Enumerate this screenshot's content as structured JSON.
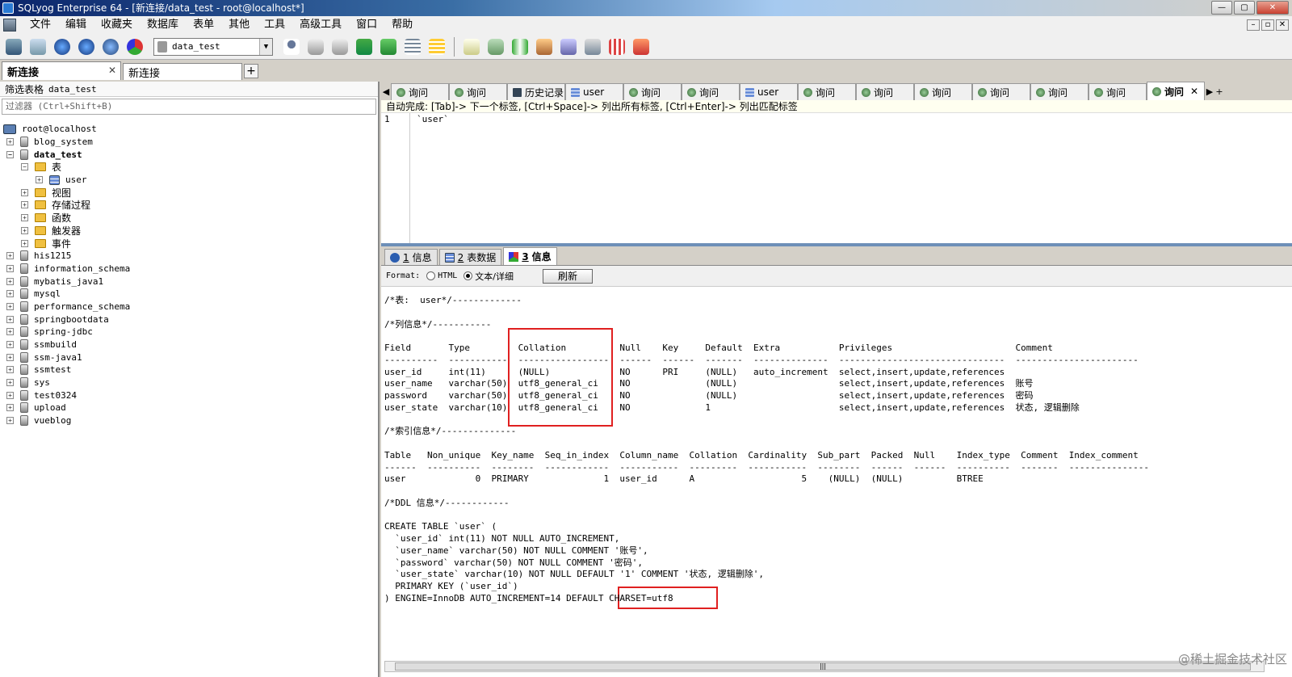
{
  "window": {
    "title": "SQLyog Enterprise 64 - [新连接/data_test - root@localhost*]"
  },
  "menu": [
    "文件",
    "编辑",
    "收藏夹",
    "数据库",
    "表单",
    "其他",
    "工具",
    "高级工具",
    "窗口",
    "帮助"
  ],
  "toolbar": {
    "database": "data_test"
  },
  "connection_tabs": [
    "新连接",
    "新连接"
  ],
  "object_browser": {
    "filter_label": "筛选表格",
    "filter_db": "data_test",
    "filter_placeholder": "过滤器 (Ctrl+Shift+B)",
    "root": "root@localhost",
    "nodes": [
      {
        "label": "blog_system",
        "level": 1,
        "type": "db",
        "exp": "+"
      },
      {
        "label": "data_test",
        "level": 1,
        "type": "db",
        "exp": "-",
        "bold": true
      },
      {
        "label": "表",
        "level": 2,
        "type": "folder",
        "exp": "-",
        "cn": true
      },
      {
        "label": "user",
        "level": 3,
        "type": "table",
        "exp": "+"
      },
      {
        "label": "视图",
        "level": 2,
        "type": "folder",
        "exp": "+",
        "cn": true
      },
      {
        "label": "存储过程",
        "level": 2,
        "type": "folder",
        "exp": "+",
        "cn": true
      },
      {
        "label": "函数",
        "level": 2,
        "type": "folder",
        "exp": "+",
        "cn": true
      },
      {
        "label": "触发器",
        "level": 2,
        "type": "folder",
        "exp": "+",
        "cn": true
      },
      {
        "label": "事件",
        "level": 2,
        "type": "folder",
        "exp": "+",
        "cn": true
      },
      {
        "label": "his1215",
        "level": 1,
        "type": "db",
        "exp": "+"
      },
      {
        "label": "information_schema",
        "level": 1,
        "type": "db",
        "exp": "+"
      },
      {
        "label": "mybatis_java1",
        "level": 1,
        "type": "db",
        "exp": "+"
      },
      {
        "label": "mysql",
        "level": 1,
        "type": "db",
        "exp": "+"
      },
      {
        "label": "performance_schema",
        "level": 1,
        "type": "db",
        "exp": "+"
      },
      {
        "label": "springbootdata",
        "level": 1,
        "type": "db",
        "exp": "+"
      },
      {
        "label": "spring-jdbc",
        "level": 1,
        "type": "db",
        "exp": "+"
      },
      {
        "label": "ssmbuild",
        "level": 1,
        "type": "db",
        "exp": "+"
      },
      {
        "label": "ssm-java1",
        "level": 1,
        "type": "db",
        "exp": "+"
      },
      {
        "label": "ssmtest",
        "level": 1,
        "type": "db",
        "exp": "+"
      },
      {
        "label": "sys",
        "level": 1,
        "type": "db",
        "exp": "+"
      },
      {
        "label": "test0324",
        "level": 1,
        "type": "db",
        "exp": "+"
      },
      {
        "label": "upload",
        "level": 1,
        "type": "db",
        "exp": "+"
      },
      {
        "label": "vueblog",
        "level": 1,
        "type": "db",
        "exp": "+"
      }
    ]
  },
  "query_tabs": [
    {
      "label": "询问",
      "icon": "query"
    },
    {
      "label": "询问",
      "icon": "query"
    },
    {
      "label": "历史记录",
      "icon": "history"
    },
    {
      "label": "user",
      "icon": "table"
    },
    {
      "label": "询问",
      "icon": "query"
    },
    {
      "label": "询问",
      "icon": "query"
    },
    {
      "label": "user",
      "icon": "table"
    },
    {
      "label": "询问",
      "icon": "query"
    },
    {
      "label": "询问",
      "icon": "query"
    },
    {
      "label": "询问",
      "icon": "query"
    },
    {
      "label": "询问",
      "icon": "query"
    },
    {
      "label": "询问",
      "icon": "query"
    },
    {
      "label": "询问",
      "icon": "query"
    },
    {
      "label": "询问",
      "icon": "query",
      "active": true
    }
  ],
  "autocomplete_hint": "自动完成: [Tab]-> 下一个标签, [Ctrl+Space]-> 列出所有标签, [Ctrl+Enter]-> 列出匹配标签",
  "editor": {
    "line_number": "1",
    "code": "`user`"
  },
  "result_tabs": [
    {
      "num": "1",
      "label": "信息"
    },
    {
      "num": "2",
      "label": "表数据"
    },
    {
      "num": "3",
      "label": "信息",
      "active": true
    }
  ],
  "format_bar": {
    "label": "Format:",
    "opt_html": "HTML",
    "opt_text": "文本/详细",
    "refresh": "刷新"
  },
  "output_lines": [
    "/*表:  user*/-------------",
    "",
    "/*列信息*/-----------",
    "",
    "Field       Type         Collation          Null    Key     Default  Extra           Privileges                       Comment",
    "----------  -----------  -----------------  ------  ------  -------  --------------  -------------------------------  -----------------------",
    "user_id     int(11)      (NULL)             NO      PRI     (NULL)   auto_increment  select,insert,update,references",
    "user_name   varchar(50)  utf8_general_ci    NO              (NULL)                   select,insert,update,references  账号",
    "password    varchar(50)  utf8_general_ci    NO              (NULL)                   select,insert,update,references  密码",
    "user_state  varchar(10)  utf8_general_ci    NO              1                        select,insert,update,references  状态, 逻辑删除",
    "",
    "/*索引信息*/--------------",
    "",
    "Table   Non_unique  Key_name  Seq_in_index  Column_name  Collation  Cardinality  Sub_part  Packed  Null    Index_type  Comment  Index_comment",
    "------  ----------  --------  ------------  -----------  ---------  -----------  --------  ------  ------  ----------  -------  ---------------",
    "user             0  PRIMARY              1  user_id      A                    5    (NULL)  (NULL)          BTREE",
    "",
    "/*DDL 信息*/------------",
    "",
    "CREATE TABLE `user` (",
    "  `user_id` int(11) NOT NULL AUTO_INCREMENT,",
    "  `user_name` varchar(50) NOT NULL COMMENT '账号',",
    "  `password` varchar(50) NOT NULL COMMENT '密码',",
    "  `user_state` varchar(10) NOT NULL DEFAULT '1' COMMENT '状态, 逻辑删除',",
    "  PRIMARY KEY (`user_id`)",
    ") ENGINE=InnoDB AUTO_INCREMENT=14 DEFAULT CHARSET=utf8"
  ],
  "watermark": "@稀土掘金技术社区",
  "colors": {
    "highlight_box": "#e02020",
    "title_gradient_start": "#0a246a"
  }
}
